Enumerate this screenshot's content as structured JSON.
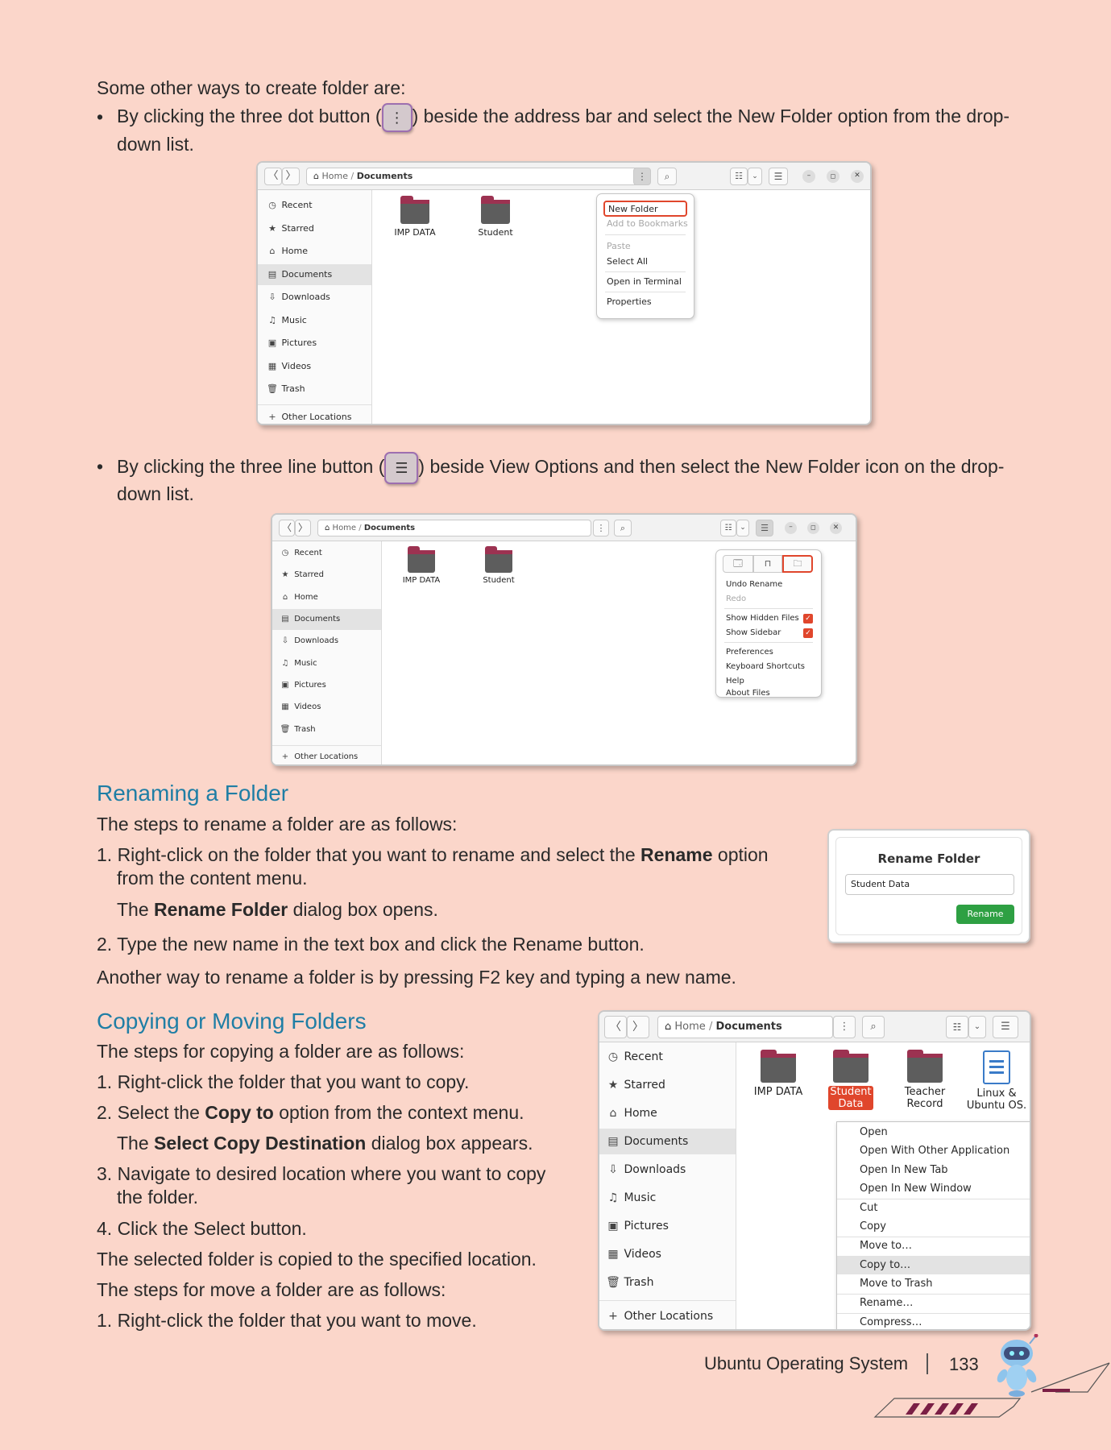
{
  "intro": {
    "heading": "Some other ways to create folder are:",
    "bullet1_a": "By clicking the three dot button (",
    "bullet1_btn": "⋮",
    "bullet1_b": ") beside the address bar and select the New Folder option from the drop-",
    "bullet1_c": "down list.",
    "bullet2_a": "By clicking the three line button (",
    "bullet2_btn": "☰",
    "bullet2_b": ") beside View Options and then select the New Folder icon on the drop-",
    "bullet2_c": "down list.",
    "bullet_mark": "•"
  },
  "window1": {
    "path_home": "Home",
    "path_sep": "/",
    "path_current": "Documents",
    "sidebar": [
      "Recent",
      "Starred",
      "Home",
      "Documents",
      "Downloads",
      "Music",
      "Pictures",
      "Videos",
      "Trash"
    ],
    "other_locations": "Other Locations",
    "folders": [
      "IMP DATA",
      "Student"
    ],
    "menu": [
      "New Folder",
      "Add to Bookmarks",
      "Paste",
      "Select All",
      "Open in Terminal",
      "Properties"
    ]
  },
  "window2": {
    "path_home": "Home",
    "path_sep": "/",
    "path_current": "Documents",
    "sidebar": [
      "Recent",
      "Starred",
      "Home",
      "Documents",
      "Downloads",
      "Music",
      "Pictures",
      "Videos",
      "Trash"
    ],
    "other_locations": "Other Locations",
    "folders": [
      "IMP DATA",
      "Student"
    ],
    "menu": [
      "Undo Rename",
      "Redo",
      "Show Hidden Files",
      "Show Sidebar",
      "Preferences",
      "Keyboard Shortcuts",
      "Help",
      "About Files"
    ]
  },
  "rename": {
    "heading": "Renaming a Folder",
    "intro": "The steps to rename a folder are as follows:",
    "step1_a": "1. Right-click on the folder that you want to rename and select the ",
    "step1_bold": "Rename",
    "step1_b": " option",
    "step1_c": "from the content menu.",
    "step1_d_a": "The ",
    "step1_d_bold": "Rename Folder",
    "step1_d_b": " dialog box opens.",
    "step2": "2. Type the new name in the text box and click the Rename button.",
    "another": "Another way to rename a folder is by pressing F2 key and typing a new name.",
    "dialog_title": "Rename Folder",
    "dialog_value": "Student Data",
    "dialog_button": "Rename"
  },
  "copy": {
    "heading": "Copying or Moving Folders",
    "intro": "The steps for copying a folder are as follows:",
    "step1": "1. Right-click the folder that you want to copy.",
    "step2_a": "2. Select the ",
    "step2_bold": "Copy to",
    "step2_b": " option from the context menu.",
    "step2_c_a": "The ",
    "step2_c_bold": "Select Copy Destination",
    "step2_c_b": " dialog box appears.",
    "step3_a": "3. Navigate to desired location where you want to copy",
    "step3_b": "the folder.",
    "step4": "4. Click the Select button.",
    "copied": "The selected folder is copied to the specified location.",
    "move_intro": "The steps for move a folder are as follows:",
    "move_step1": "1. Right-click the folder that you want to move."
  },
  "window3": {
    "path_home": "Home",
    "path_sep": "/",
    "path_current": "Documents",
    "sidebar": [
      "Recent",
      "Starred",
      "Home",
      "Documents",
      "Downloads",
      "Music",
      "Pictures",
      "Videos",
      "Trash"
    ],
    "other_locations": "Other Locations",
    "folders": [
      {
        "l1": "IMP DATA",
        "l2": ""
      },
      {
        "l1": "Student",
        "l2": "Data"
      },
      {
        "l1": "Teacher",
        "l2": "Record"
      },
      {
        "l1": "Linux &",
        "l2": "Ubuntu OS."
      }
    ],
    "menu": [
      "Open",
      "Open With Other Application",
      "Open In New Tab",
      "Open In New Window",
      "Cut",
      "Copy",
      "Move to…",
      "Copy to…",
      "Move to Trash",
      "Rename…",
      "Compress…"
    ]
  },
  "footer": {
    "title": "Ubuntu Operating System",
    "page": "133"
  },
  "colors": {
    "page_bg": "#fbd6ca",
    "heading": "#1f7ea5",
    "accent_red": "#e0462c",
    "rename_green": "#2ea043",
    "folder_top": "#9c3251"
  }
}
